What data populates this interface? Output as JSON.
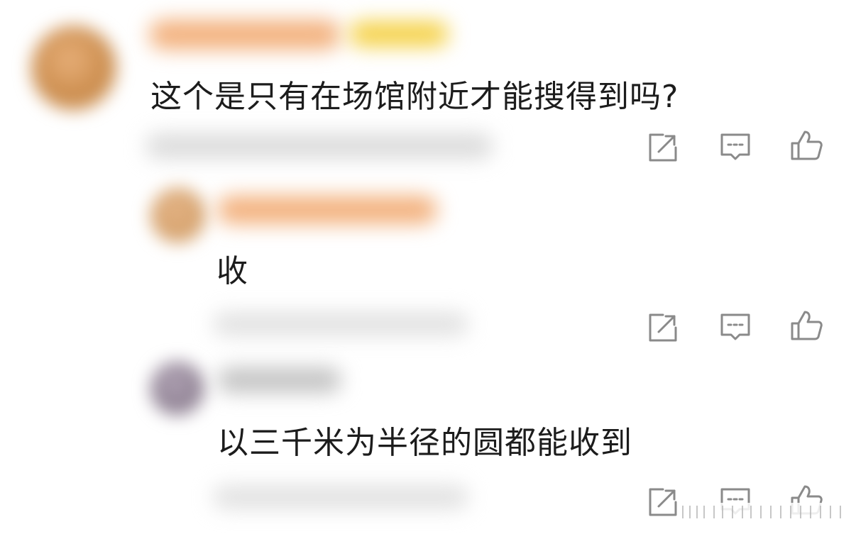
{
  "comments": [
    {
      "text": "这个是只有在场馆附近才能搜得到吗?",
      "actions": [
        "share-icon",
        "comment-icon",
        "like-icon"
      ]
    },
    {
      "text": "收",
      "actions": [
        "share-icon",
        "comment-icon",
        "like-icon"
      ]
    },
    {
      "text": "以三千米为半径的圆都能收到",
      "actions": [
        "share-icon",
        "comment-icon",
        "like-icon"
      ]
    }
  ],
  "colors": {
    "text": "#1c1c1c",
    "icon": "#8a8a8a",
    "blur_meta": "#d9d9d9",
    "username_orange": "#f3b27f",
    "badge_yellow": "#f5d24a",
    "avatar_1": "#c98a4a",
    "avatar_2": "#d4a06a",
    "avatar_3": "#8b7d8f"
  }
}
